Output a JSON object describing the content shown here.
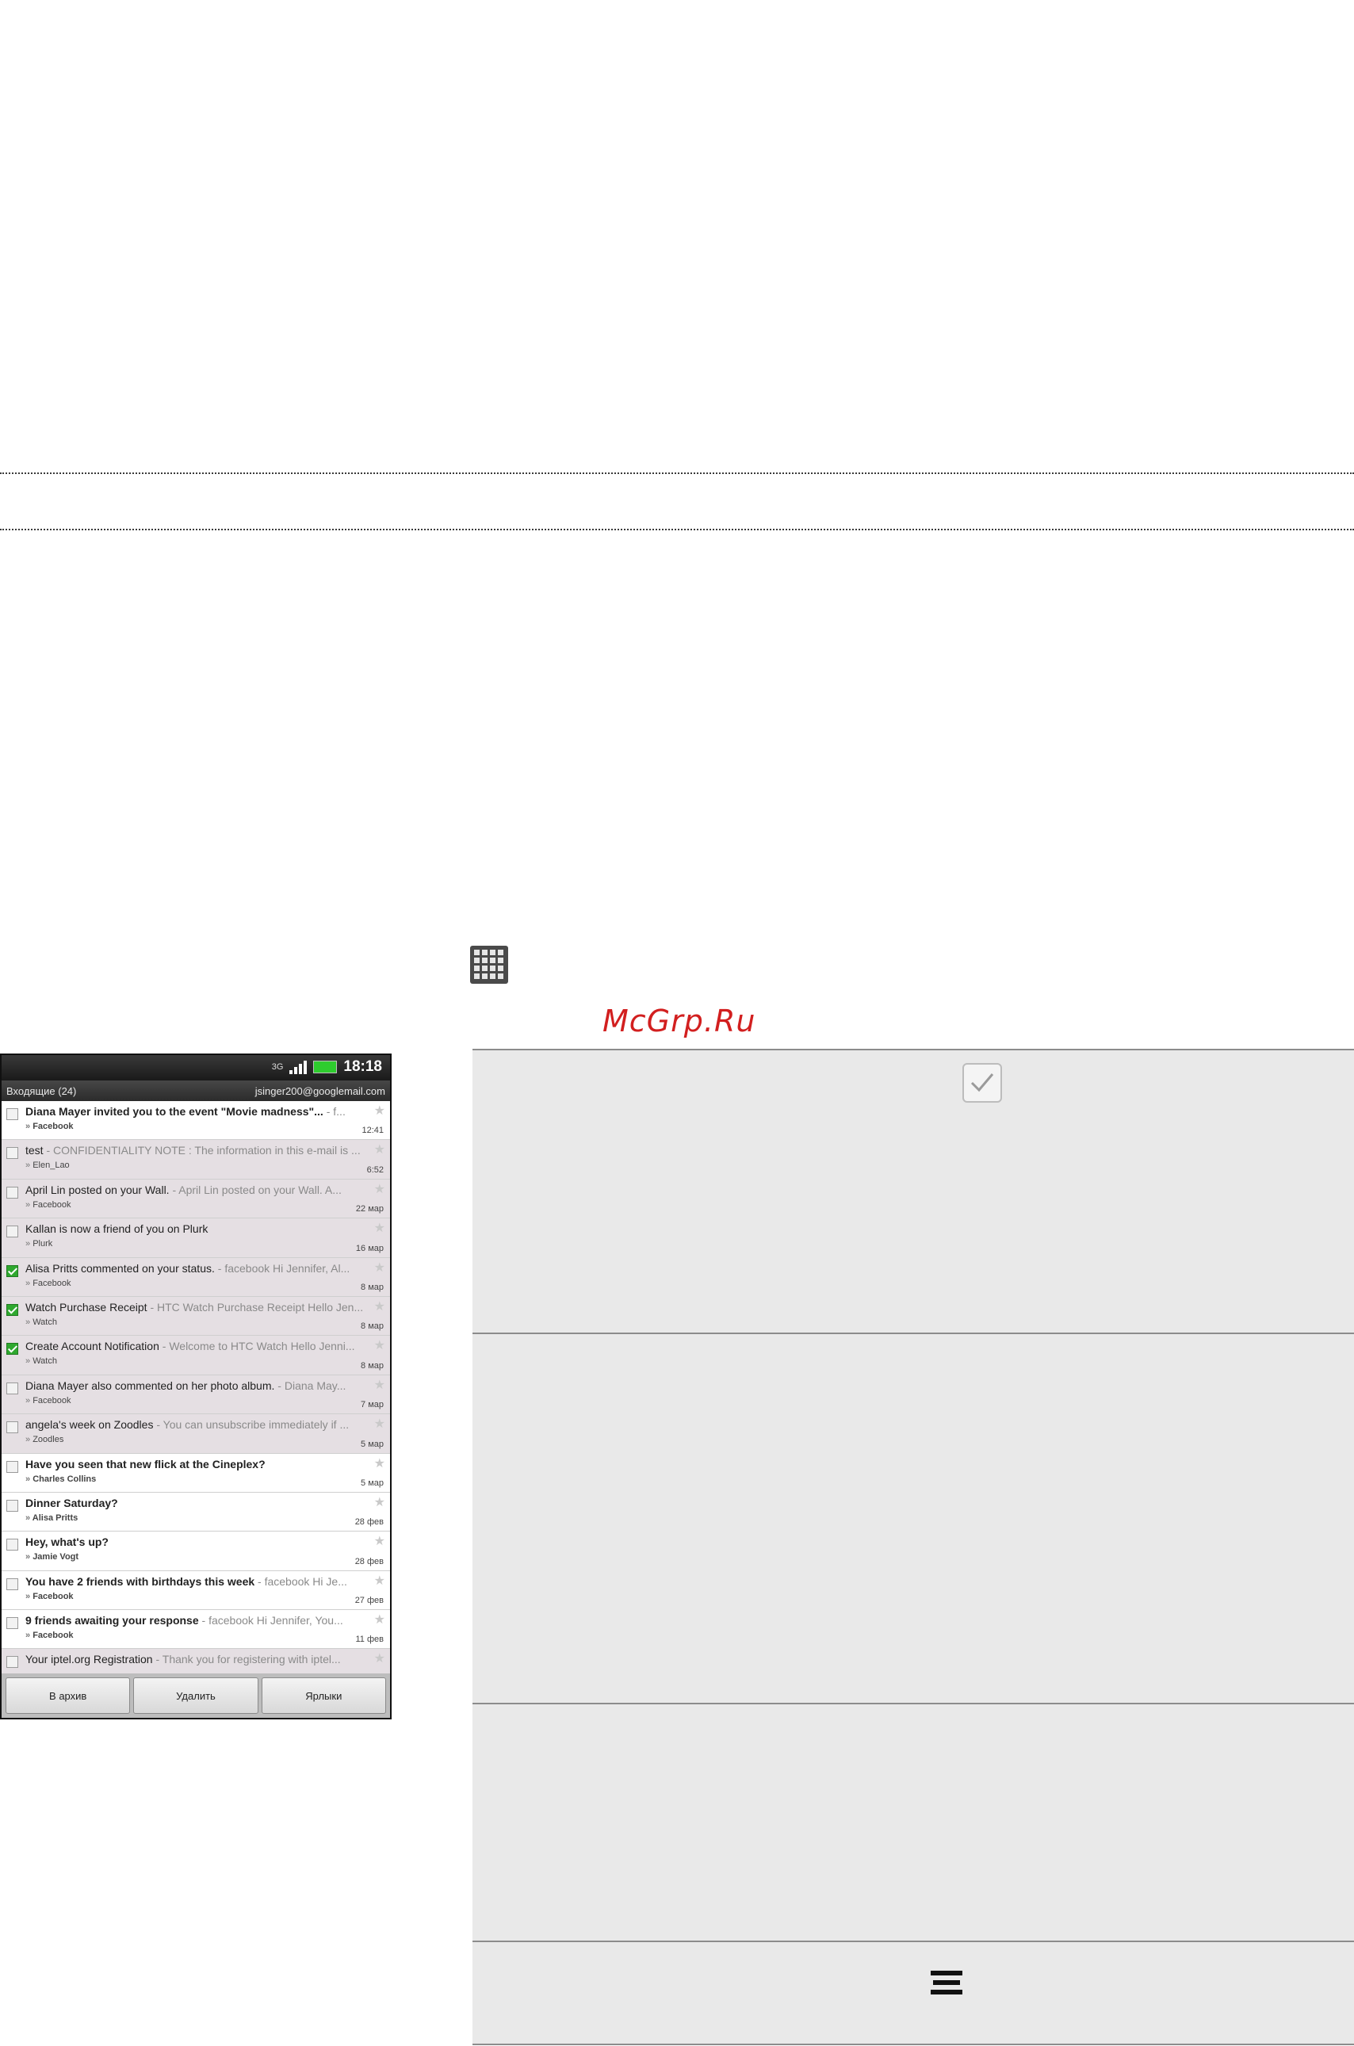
{
  "watermark": "McGrp.Ru",
  "phone": {
    "status": {
      "network": "3G",
      "time": "18:18"
    },
    "header": {
      "folder": "Входящие (24)",
      "account": "jsinger200@googlemail.com"
    },
    "messages": [
      {
        "subject": "Diana Mayer invited you to the event \"Movie madness\"...",
        "snippet": " - f...",
        "label": "Facebook",
        "date": "12:41",
        "read": false,
        "checked": false
      },
      {
        "subject": "test",
        "snippet": " - CONFIDENTIALITY NOTE : The information in this e-mail is ...",
        "label": "Elen_Lao",
        "date": "6:52",
        "read": true,
        "checked": false
      },
      {
        "subject": "April Lin posted on your Wall.",
        "snippet": " - April Lin posted on your Wall. A...",
        "label": "Facebook",
        "date": "22 мар",
        "read": true,
        "checked": false
      },
      {
        "subject": "Kallan is now a friend of you on Plurk",
        "snippet": "",
        "label": "Plurk",
        "date": "16 мар",
        "read": true,
        "checked": false
      },
      {
        "subject": "Alisa Pritts commented on your status.",
        "snippet": " - facebook Hi Jennifer, Al...",
        "label": "Facebook",
        "date": "8 мар",
        "read": true,
        "checked": true
      },
      {
        "subject": "Watch Purchase Receipt",
        "snippet": " - HTC Watch Purchase Receipt Hello Jen...",
        "label": "Watch",
        "date": "8 мар",
        "read": true,
        "checked": true
      },
      {
        "subject": "Create Account Notification",
        "snippet": " - Welcome to HTC Watch Hello Jenni...",
        "label": "Watch",
        "date": "8 мар",
        "read": true,
        "checked": true
      },
      {
        "subject": "Diana Mayer also commented on her photo album.",
        "snippet": " - Diana May...",
        "label": "Facebook",
        "date": "7 мар",
        "read": true,
        "checked": false
      },
      {
        "subject": "angela's week on Zoodles",
        "snippet": " - You can unsubscribe immediately if ...",
        "label": "Zoodles",
        "date": "5 мар",
        "read": true,
        "checked": false
      },
      {
        "subject": "Have you seen that new flick at the Cineplex?",
        "snippet": "",
        "label": "Charles Collins",
        "date": "5 мар",
        "read": false,
        "checked": false
      },
      {
        "subject": "Dinner Saturday?",
        "snippet": "",
        "label": "Alisa Pritts",
        "date": "28 фев",
        "read": false,
        "checked": false
      },
      {
        "subject": "Hey, what's up?",
        "snippet": "",
        "label": "Jamie Vogt",
        "date": "28 фев",
        "read": false,
        "checked": false
      },
      {
        "subject": "You have 2 friends with birthdays this week",
        "snippet": " - facebook Hi Je...",
        "label": "Facebook",
        "date": "27 фев",
        "read": false,
        "checked": false
      },
      {
        "subject": "9 friends awaiting your response",
        "snippet": " - facebook Hi Jennifer, You...",
        "label": "Facebook",
        "date": "11 фев",
        "read": false,
        "checked": false
      },
      {
        "subject": "Your iptel.org Registration",
        "snippet": " - Thank you for registering with iptel...",
        "label": "",
        "date": "",
        "read": true,
        "checked": false
      }
    ],
    "buttons": {
      "archive": "В архив",
      "delete": "Удалить",
      "labels": "Ярлыки"
    }
  },
  "icons": {
    "apps": "all-apps-grid-icon",
    "check": "checkbox-checked-icon",
    "menu": "menu-icon"
  }
}
